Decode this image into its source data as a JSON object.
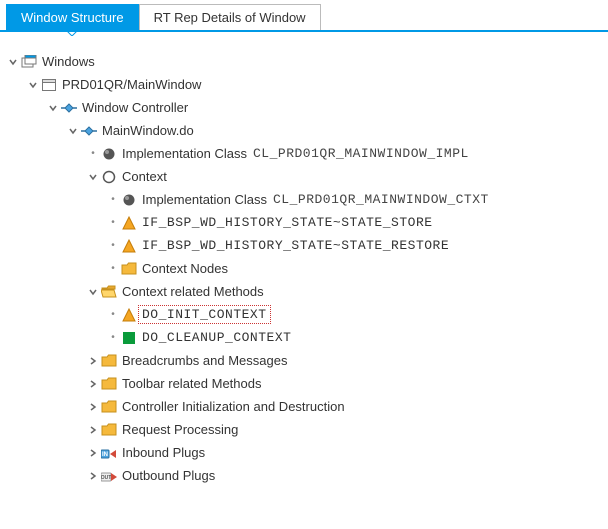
{
  "tabs": {
    "active": "Window Structure",
    "inactive": "RT Rep Details of Window"
  },
  "tree": {
    "root": "Windows",
    "component": "PRD01QR/MainWindow",
    "controller": "Window Controller",
    "view": "MainWindow.do",
    "impl_class_label": "Implementation Class",
    "impl_class_value": "CL_PRD01QR_MAINWINDOW_IMPL",
    "context_label": "Context",
    "ctxt_impl_label": "Implementation Class",
    "ctxt_impl_value": "CL_PRD01QR_MAINWINDOW_CTXT",
    "state_store": "IF_BSP_WD_HISTORY_STATE~STATE_STORE",
    "state_restore": "IF_BSP_WD_HISTORY_STATE~STATE_RESTORE",
    "context_nodes": "Context Nodes",
    "context_methods": "Context related Methods",
    "do_init": "DO_INIT_CONTEXT",
    "do_cleanup": "DO_CLEANUP_CONTEXT",
    "breadcrumbs": "Breadcrumbs and Messages",
    "toolbar": "Toolbar related Methods",
    "ctrl_init": "Controller Initialization and Destruction",
    "req_proc": "Request Processing",
    "inbound": "Inbound Plugs",
    "outbound": "Outbound Plugs"
  }
}
